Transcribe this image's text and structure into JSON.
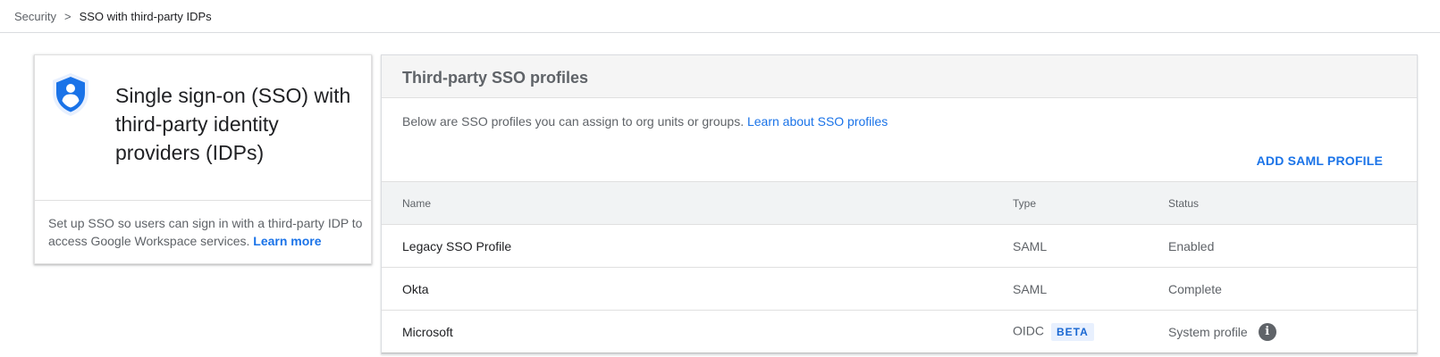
{
  "breadcrumb": {
    "parent": "Security",
    "separator": ">",
    "current": "SSO with third-party IDPs"
  },
  "left_card": {
    "icon": "shield-user-icon",
    "title": "Single sign-on (SSO) with third-party identity providers (IDPs)",
    "description": "Set up SSO so users can sign in with a third-party IDP to access Google Workspace services.",
    "learn_more": "Learn more"
  },
  "right_card": {
    "title": "Third-party SSO profiles",
    "intro": "Below are SSO profiles you can assign to org units or groups.",
    "intro_link": "Learn about SSO profiles",
    "add_button": "ADD SAML PROFILE",
    "table": {
      "headers": {
        "name": "Name",
        "type": "Type",
        "status": "Status"
      },
      "rows": [
        {
          "name": "Legacy SSO Profile",
          "type": "SAML",
          "badge": "",
          "status": "Enabled",
          "info": false
        },
        {
          "name": "Okta",
          "type": "SAML",
          "badge": "",
          "status": "Complete",
          "info": false
        },
        {
          "name": "Microsoft",
          "type": "OIDC",
          "badge": "BETA",
          "status": "System profile",
          "info": true
        }
      ]
    }
  },
  "colors": {
    "accent": "#1a73e8",
    "shield": "#1a73e8",
    "header_bg": "#f5f5f5"
  }
}
